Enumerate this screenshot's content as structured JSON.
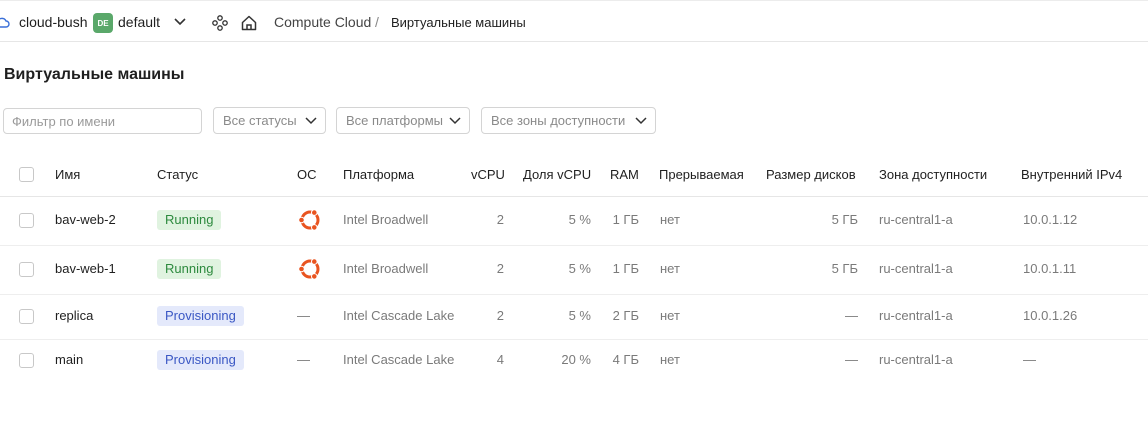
{
  "header": {
    "cloud_name": "cloud-bush",
    "folder_badge": "DE",
    "folder_name": "default",
    "service": "Compute Cloud",
    "separator": "/",
    "current_page": "Виртуальные машины"
  },
  "page": {
    "title": "Виртуальные машины"
  },
  "filters": {
    "name_placeholder": "Фильтр по имени",
    "status_select": "Все статусы",
    "platform_select": "Все платформы",
    "zone_select": "Все зоны доступности"
  },
  "table": {
    "columns": {
      "name": "Имя",
      "status": "Статус",
      "os": "ОС",
      "platform": "Платформа",
      "vcpu": "vCPU",
      "vcpu_share": "Доля vCPU",
      "ram": "RAM",
      "preemptible": "Прерываемая",
      "disk_size": "Размер дисков",
      "zone": "Зона доступности",
      "internal_ip": "Внутренний IPv4"
    },
    "rows": [
      {
        "name": "bav-web-2",
        "status": "Running",
        "os": "ubuntu-icon",
        "platform": "Intel Broadwell",
        "vcpu": "2",
        "vcpu_share": "5 %",
        "ram": "1 ГБ",
        "preemptible": "нет",
        "disk_size": "5 ГБ",
        "zone": "ru-central1-a",
        "internal_ip": "10.0.1.12"
      },
      {
        "name": "bav-web-1",
        "status": "Running",
        "os": "ubuntu-icon",
        "platform": "Intel Broadwell",
        "vcpu": "2",
        "vcpu_share": "5 %",
        "ram": "1 ГБ",
        "preemptible": "нет",
        "disk_size": "5 ГБ",
        "zone": "ru-central1-a",
        "internal_ip": "10.0.1.11"
      },
      {
        "name": "replica",
        "status": "Provisioning",
        "os": "—",
        "platform": "Intel Cascade Lake",
        "vcpu": "2",
        "vcpu_share": "5 %",
        "ram": "2 ГБ",
        "preemptible": "нет",
        "disk_size": "—",
        "zone": "ru-central1-a",
        "internal_ip": "10.0.1.26"
      },
      {
        "name": "main",
        "status": "Provisioning",
        "os": "—",
        "platform": "Intel Cascade Lake",
        "vcpu": "4",
        "vcpu_share": "20 %",
        "ram": "4 ГБ",
        "preemptible": "нет",
        "disk_size": "—",
        "zone": "ru-central1-a",
        "internal_ip": "—"
      }
    ]
  },
  "colors": {
    "running_bg": "#e0f3e0",
    "running_text": "#2d8a3e",
    "provisioning_bg": "#e4e9fb",
    "provisioning_text": "#3a57c4",
    "ubuntu_orange": "#e95420",
    "folder_badge": "#5aa86a"
  }
}
